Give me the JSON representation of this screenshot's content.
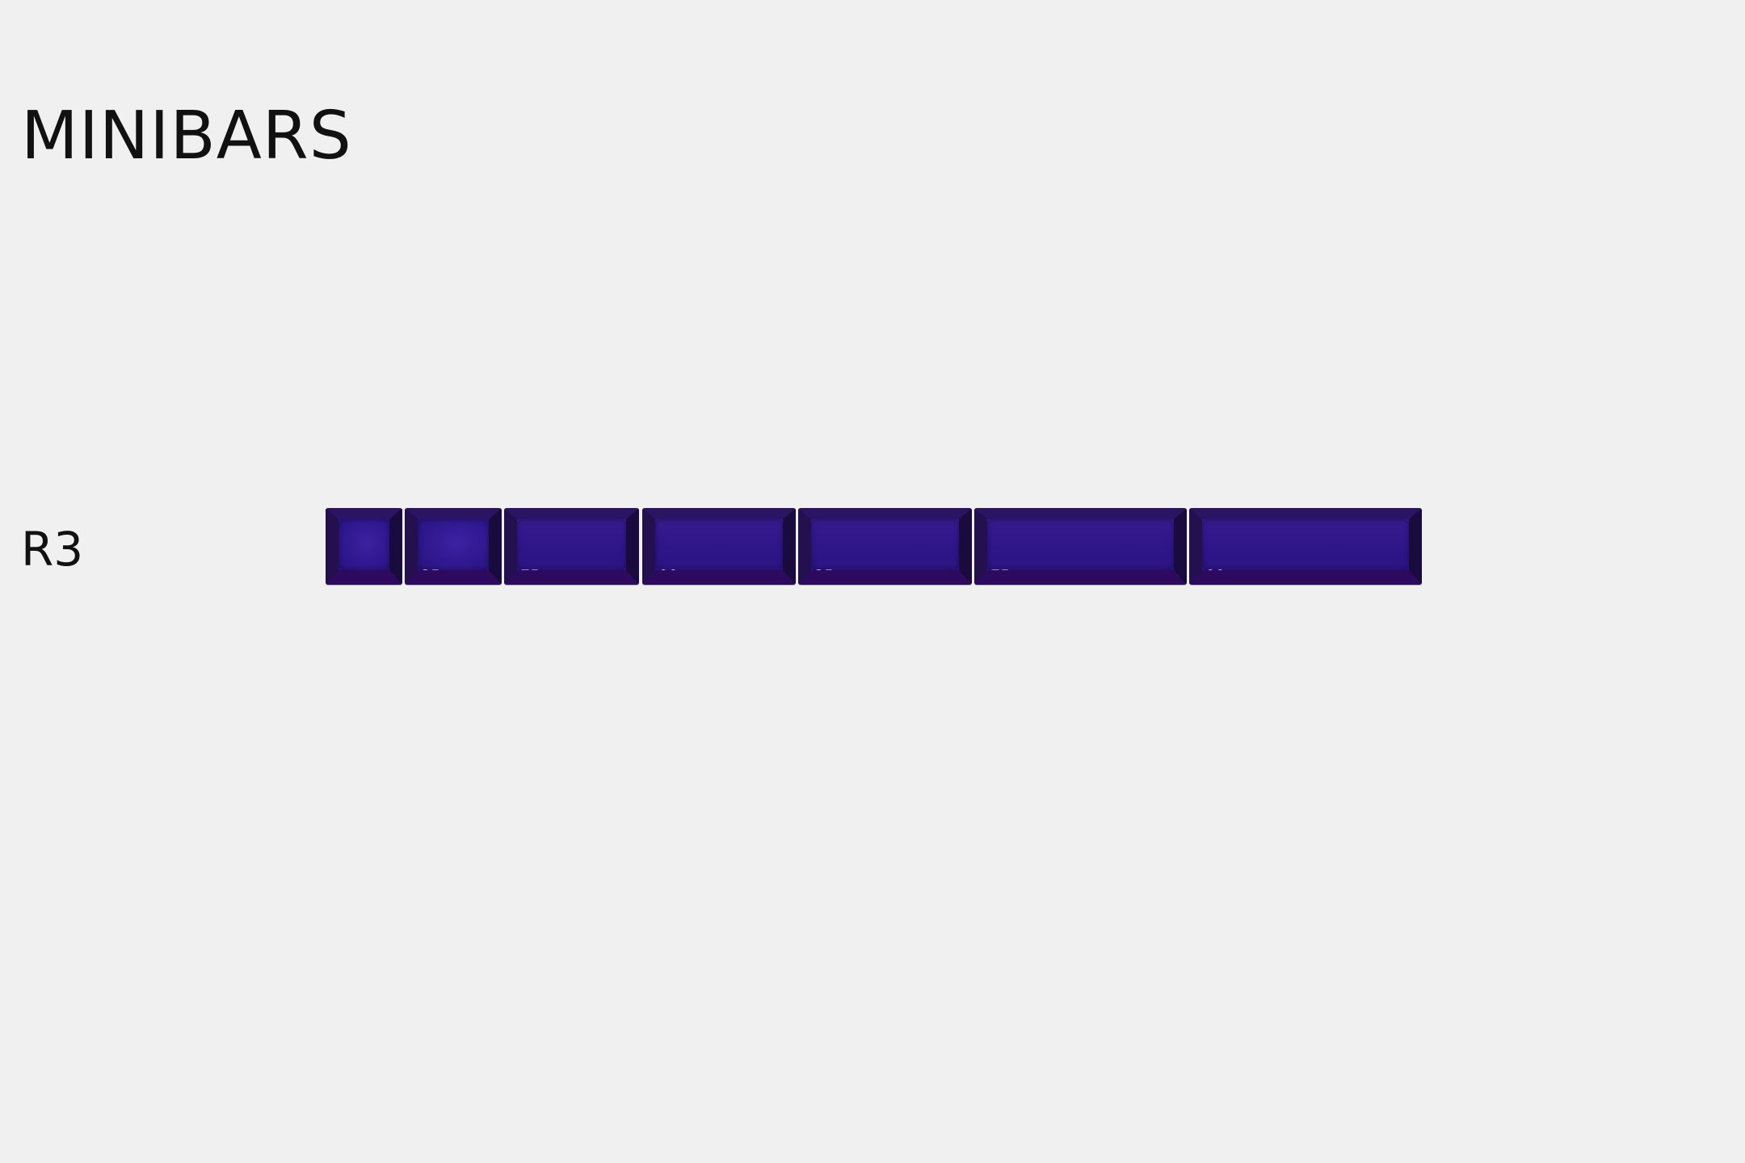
{
  "title": "MINIBARS",
  "row": {
    "label": "R3",
    "keys": [
      {
        "size": ""
      },
      {
        "size": "1.25"
      },
      {
        "size": "1.75"
      },
      {
        "size": "2.00"
      },
      {
        "size": "2.25"
      },
      {
        "size": "2.75"
      },
      {
        "size": "3.00"
      }
    ]
  },
  "colors": {
    "background": "#f0f0f0",
    "keycap": "#2f168a",
    "text": "#111111",
    "legend": "#ffffff"
  }
}
